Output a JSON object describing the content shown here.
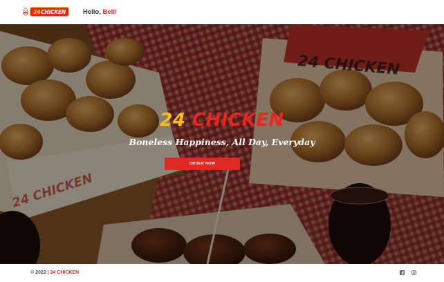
{
  "header": {
    "logo": {
      "number": "24",
      "word": "CHICKEN"
    },
    "greeting_prefix": "Hello, ",
    "greeting_name": "Bell!"
  },
  "hero": {
    "title_number": "24",
    "title_word": "CHICKEN",
    "tagline": "Boneless Happiness, All Day, Everyday",
    "order_button": "ORDER NOW",
    "box_print_top": "24 CHICKEN",
    "box_print_left": "24 CHICKEN"
  },
  "footer": {
    "copyright_prefix": "© 2022 | ",
    "copyright_brand": "24 CHICKEN",
    "social_icons": [
      "facebook-icon",
      "instagram-icon"
    ]
  },
  "colors": {
    "brand_red": "#e8261f",
    "brand_yellow": "#f7bd1b",
    "button_red": "#dd2a25"
  }
}
